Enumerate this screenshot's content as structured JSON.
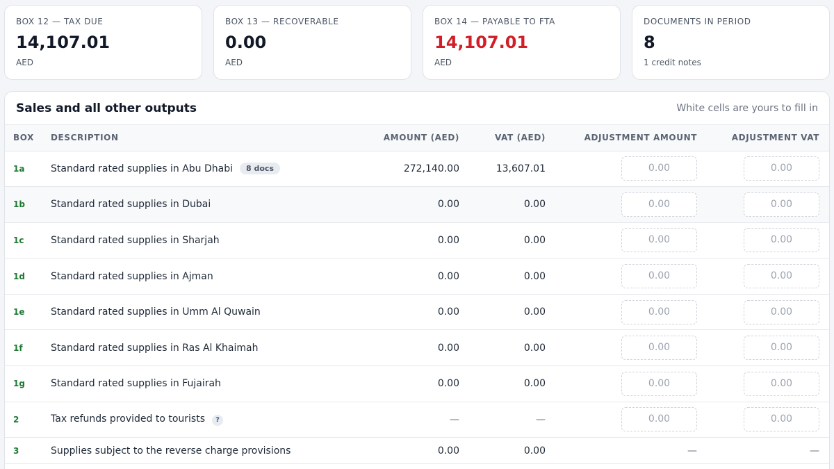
{
  "summary_cards": [
    {
      "label": "BOX 12 — TAX DUE",
      "value": "14,107.01",
      "sub": "AED"
    },
    {
      "label": "BOX 13 — RECOVERABLE",
      "value": "0.00",
      "sub": "AED"
    },
    {
      "label": "BOX 14 — PAYABLE TO FTA",
      "value": "14,107.01",
      "sub": "AED"
    },
    {
      "label": "DOCUMENTS IN PERIOD",
      "value": "8",
      "sub": "1 credit notes"
    }
  ],
  "colors": {
    "payable_value": "#d11f2a",
    "box_code": "#1f7a34"
  },
  "panel": {
    "title": "Sales and all other outputs",
    "hint": "White cells are yours to fill in",
    "columns": [
      "BOX",
      "DESCRIPTION",
      "AMOUNT (AED)",
      "VAT (AED)",
      "ADJUSTMENT AMOUNT",
      "ADJUSTMENT VAT"
    ],
    "rows": [
      {
        "box": "1a",
        "description": "Standard rated supplies in Abu Dhabi",
        "badge": "8 docs",
        "amount": "272,140.00",
        "vat": "13,607.01",
        "adj_amount": "0.00",
        "adj_vat": "0.00"
      },
      {
        "box": "1b",
        "description": "Standard rated supplies in Dubai",
        "amount": "0.00",
        "vat": "0.00",
        "adj_amount": "0.00",
        "adj_vat": "0.00"
      },
      {
        "box": "1c",
        "description": "Standard rated supplies in Sharjah",
        "amount": "0.00",
        "vat": "0.00",
        "adj_amount": "0.00",
        "adj_vat": "0.00"
      },
      {
        "box": "1d",
        "description": "Standard rated supplies in Ajman",
        "amount": "0.00",
        "vat": "0.00",
        "adj_amount": "0.00",
        "adj_vat": "0.00"
      },
      {
        "box": "1e",
        "description": "Standard rated supplies in Umm Al Quwain",
        "amount": "0.00",
        "vat": "0.00",
        "adj_amount": "0.00",
        "adj_vat": "0.00"
      },
      {
        "box": "1f",
        "description": "Standard rated supplies in Ras Al Khaimah",
        "amount": "0.00",
        "vat": "0.00",
        "adj_amount": "0.00",
        "adj_vat": "0.00"
      },
      {
        "box": "1g",
        "description": "Standard rated supplies in Fujairah",
        "amount": "0.00",
        "vat": "0.00",
        "adj_amount": "0.00",
        "adj_vat": "0.00"
      },
      {
        "box": "2",
        "description": "Tax refunds provided to tourists",
        "help": "?",
        "amount": "—",
        "vat": "—",
        "adj_amount": "0.00",
        "adj_vat": "0.00"
      },
      {
        "box": "3",
        "description": "Supplies subject to the reverse charge provisions",
        "amount": "0.00",
        "vat": "0.00",
        "adj_amount": "—",
        "adj_vat": "—"
      }
    ]
  }
}
